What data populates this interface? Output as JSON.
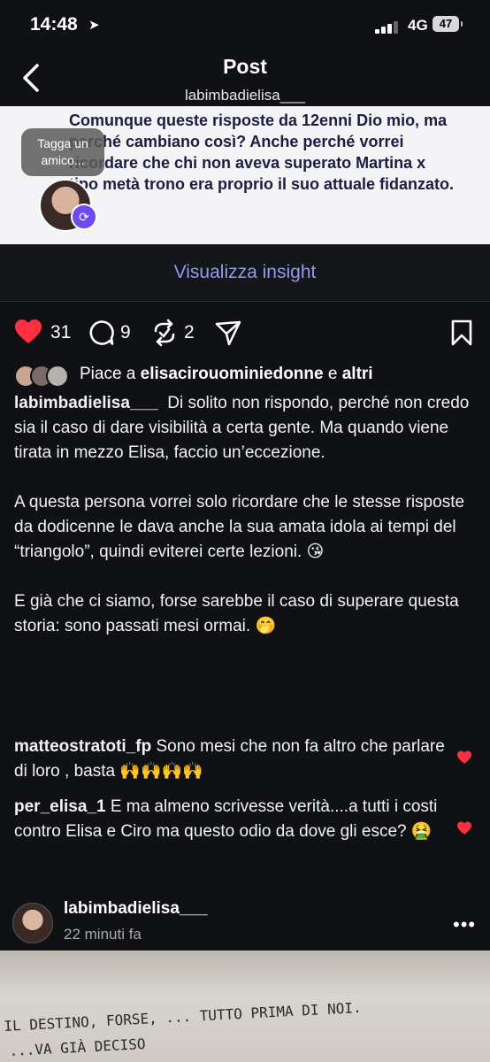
{
  "status_bar": {
    "time": "14:48",
    "network": "4G",
    "battery": "47"
  },
  "header": {
    "title": "Post",
    "username": "labimbadielisa___"
  },
  "quoted_post": {
    "text": "Comunque queste risposte da 12enni Dio mio, ma perché cambiano così? Anche perché vorrei ricordare che chi non aveva superato Martina x tipo metà trono era proprio il suo attuale fidanzato. 🥱",
    "tag_tooltip": "Tagga un amico..."
  },
  "insights": {
    "label": "Visualizza insight"
  },
  "actions": {
    "likes": "31",
    "comments": "9",
    "reposts": "2"
  },
  "likes_row": {
    "prefix": "Piace a",
    "user": "elisacirouominiedonne",
    "conj": "e",
    "others": "altri"
  },
  "caption": {
    "username": "labimbadielisa___",
    "p1": "Di solito non rispondo, perché non credo sia il caso di dare visibilità a certa gente. Ma quando viene tirata in mezzo Elisa, faccio un’eccezione.",
    "p2": "A questa persona vorrei solo ricordare che le stesse risposte da dodicenne le dava anche la sua amata idola ai tempi del “triangolo”, quindi eviterei certe lezioni. 😘",
    "p3": "E già che ci siamo, forse sarebbe il caso di superare questa storia: sono passati mesi ormai. 🤭"
  },
  "comments": [
    {
      "username": "matteostratoti_fp",
      "text": "Sono mesi che non fa altro che parlare di loro , basta 🙌🙌🙌🙌"
    },
    {
      "username": "per_elisa_1",
      "text": "E ma almeno scrivesse verità....a tutti i costi contro Elisa e Ciro ma questo odio da dove gli esce? 🤮"
    }
  ],
  "next_post": {
    "username": "labimbadielisa___",
    "time": "22 minuti fa",
    "photo_text_line1": "IL DESTINO, FORSE, ... TUTTO PRIMA DI NOI.",
    "photo_text_line2": "...VA GIÀ DECISO"
  },
  "colors": {
    "accent": "#8f9af5",
    "like": "#ff3040",
    "background": "#0f1115"
  }
}
